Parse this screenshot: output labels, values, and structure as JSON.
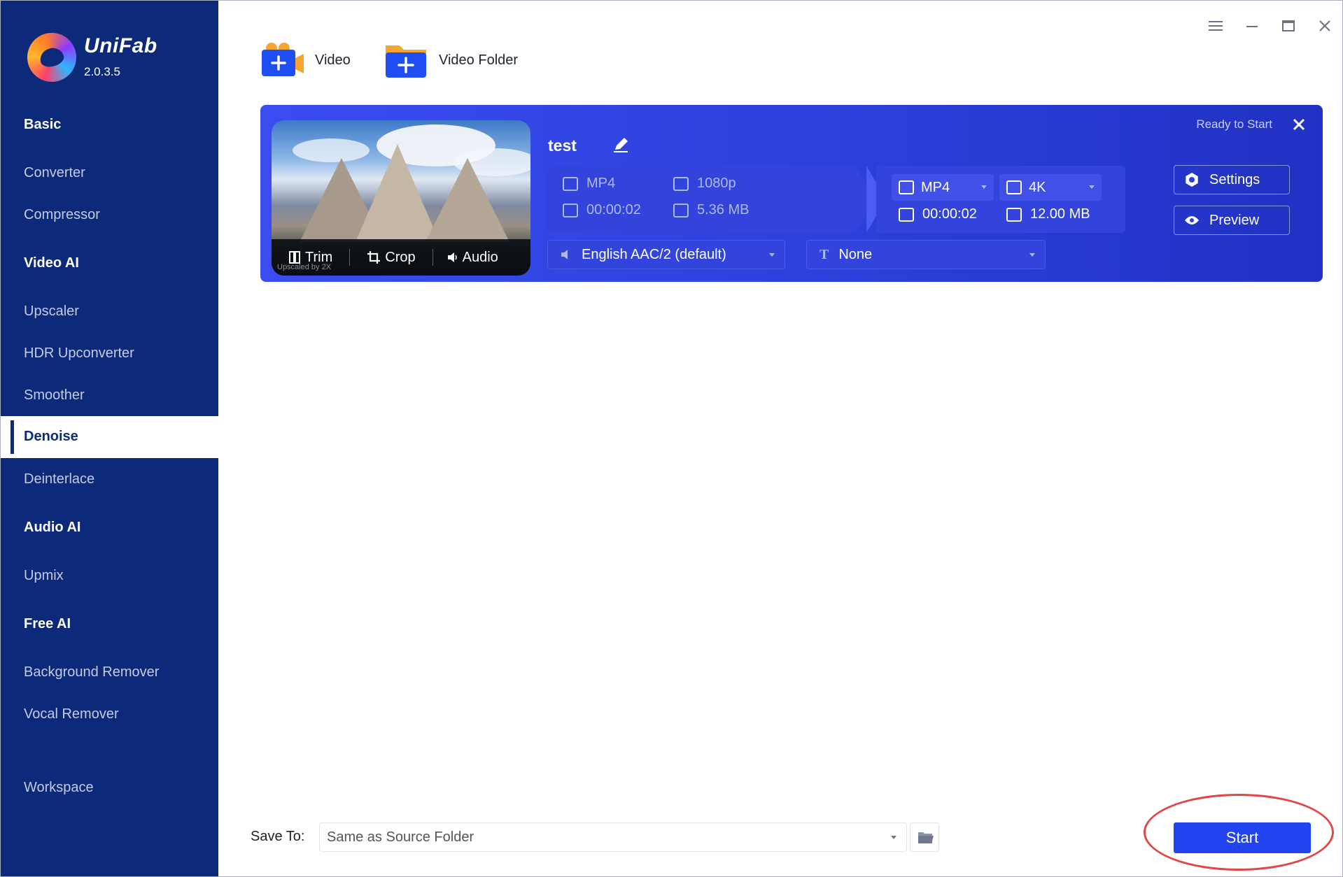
{
  "app": {
    "name": "UniFab",
    "version": "2.0.3.5"
  },
  "sidebar": {
    "sections": [
      {
        "label": "Basic",
        "items": [
          "Converter",
          "Compressor"
        ]
      },
      {
        "label": "Video AI",
        "items": [
          "Upscaler",
          "HDR Upconverter",
          "Smoother",
          "Denoise",
          "Deinterlace"
        ]
      },
      {
        "label": "Audio AI",
        "items": [
          "Upmix"
        ]
      },
      {
        "label": "Free AI",
        "items": [
          "Background Remover",
          "Vocal Remover"
        ]
      }
    ],
    "active_item": "Denoise",
    "workspace": "Workspace"
  },
  "toolbar": {
    "add_video": "Video",
    "add_folder": "Video Folder"
  },
  "task": {
    "title": "test",
    "status": "Ready to Start",
    "thumbnail_tools": {
      "trim": "Trim",
      "crop": "Crop",
      "audio": "Audio"
    },
    "watermark": "Upscaled by 2X",
    "source": {
      "format": "MP4",
      "resolution": "1080p",
      "duration": "00:00:02",
      "size": "5.36 MB"
    },
    "output": {
      "format": "MP4",
      "resolution": "4K",
      "duration": "00:00:02",
      "size": "12.00 MB"
    },
    "audio_track": "English AAC/2 (default)",
    "subtitle": "None",
    "settings_label": "Settings",
    "preview_label": "Preview"
  },
  "footer": {
    "save_to_label": "Save To:",
    "save_to_value": "Same as Source Folder",
    "start_label": "Start"
  },
  "colors": {
    "sidebar_bg": "#0d2a7a",
    "card_accent": "#2a3fd8",
    "start_button": "#2244f0",
    "highlight_ring": "#e04848"
  }
}
